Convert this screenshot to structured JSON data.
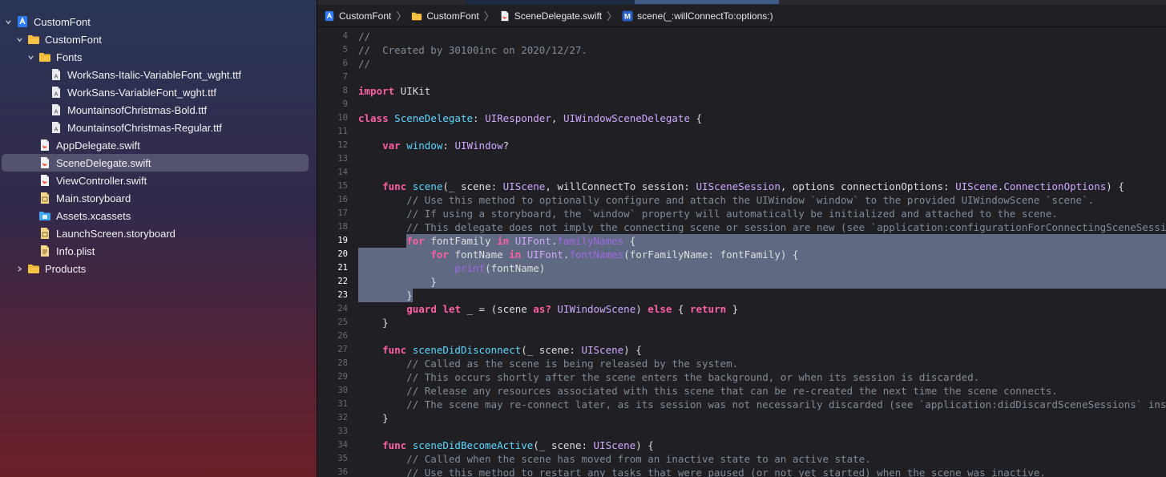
{
  "navigator": {
    "items": [
      {
        "label": "CustomFont",
        "indent": 0,
        "disclosure": "down",
        "icon": "xcode-project-icon",
        "selected": false
      },
      {
        "label": "CustomFont",
        "indent": 1,
        "disclosure": "down",
        "icon": "folder-icon",
        "selected": false
      },
      {
        "label": "Fonts",
        "indent": 2,
        "disclosure": "down",
        "icon": "folder-icon",
        "selected": false
      },
      {
        "label": "WorkSans-Italic-VariableFont_wght.ttf",
        "indent": 3,
        "disclosure": "none",
        "icon": "font-file-icon",
        "selected": false
      },
      {
        "label": "WorkSans-VariableFont_wght.ttf",
        "indent": 3,
        "disclosure": "none",
        "icon": "font-file-icon",
        "selected": false
      },
      {
        "label": "MountainsofChristmas-Bold.ttf",
        "indent": 3,
        "disclosure": "none",
        "icon": "font-file-icon",
        "selected": false
      },
      {
        "label": "MountainsofChristmas-Regular.ttf",
        "indent": 3,
        "disclosure": "none",
        "icon": "font-file-icon",
        "selected": false
      },
      {
        "label": "AppDelegate.swift",
        "indent": 2,
        "disclosure": "none",
        "icon": "swift-file-icon",
        "selected": false
      },
      {
        "label": "SceneDelegate.swift",
        "indent": 2,
        "disclosure": "none",
        "icon": "swift-file-icon",
        "selected": true
      },
      {
        "label": "ViewController.swift",
        "indent": 2,
        "disclosure": "none",
        "icon": "swift-file-icon",
        "selected": false
      },
      {
        "label": "Main.storyboard",
        "indent": 2,
        "disclosure": "none",
        "icon": "storyboard-file-icon",
        "selected": false
      },
      {
        "label": "Assets.xcassets",
        "indent": 2,
        "disclosure": "none",
        "icon": "assets-folder-icon",
        "selected": false
      },
      {
        "label": "LaunchScreen.storyboard",
        "indent": 2,
        "disclosure": "none",
        "icon": "storyboard-file-icon",
        "selected": false
      },
      {
        "label": "Info.plist",
        "indent": 2,
        "disclosure": "none",
        "icon": "plist-file-icon",
        "selected": false
      },
      {
        "label": "Products",
        "indent": 1,
        "disclosure": "right",
        "icon": "folder-icon",
        "selected": false
      }
    ]
  },
  "jumpbar": {
    "crumbs": [
      {
        "label": "CustomFont",
        "icon": "xcode-project-icon"
      },
      {
        "label": "CustomFont",
        "icon": "folder-icon"
      },
      {
        "label": "SceneDelegate.swift",
        "icon": "swift-file-icon"
      },
      {
        "label": "scene(_:willConnectTo:options:)",
        "icon": "method-icon"
      }
    ],
    "separator": "〉",
    "method_badge": "M"
  },
  "editor": {
    "highlighted_lines": [
      19,
      20,
      21,
      22,
      23
    ],
    "lines": [
      {
        "n": 4,
        "spans": [
          [
            "cm",
            "//"
          ]
        ]
      },
      {
        "n": 5,
        "spans": [
          [
            "cm",
            "//  Created by 30100inc on 2020/12/27."
          ]
        ]
      },
      {
        "n": 6,
        "spans": [
          [
            "cm",
            "//"
          ]
        ]
      },
      {
        "n": 7,
        "spans": []
      },
      {
        "n": 8,
        "spans": [
          [
            "kw",
            "import"
          ],
          [
            "",
            " UIKit"
          ]
        ]
      },
      {
        "n": 9,
        "spans": []
      },
      {
        "n": 10,
        "spans": [
          [
            "kw",
            "class"
          ],
          [
            "",
            " "
          ],
          [
            "fn",
            "SceneDelegate"
          ],
          [
            "",
            ": "
          ],
          [
            "ty",
            "UIResponder"
          ],
          [
            "",
            ", "
          ],
          [
            "ty",
            "UIWindowSceneDelegate"
          ],
          [
            "",
            " {"
          ]
        ]
      },
      {
        "n": 11,
        "spans": []
      },
      {
        "n": 12,
        "spans": [
          [
            "",
            "    "
          ],
          [
            "kw",
            "var"
          ],
          [
            "",
            " "
          ],
          [
            "fn",
            "window"
          ],
          [
            "",
            ": "
          ],
          [
            "ty",
            "UIWindow"
          ],
          [
            "",
            "?"
          ]
        ]
      },
      {
        "n": 13,
        "spans": []
      },
      {
        "n": 14,
        "spans": []
      },
      {
        "n": 15,
        "spans": [
          [
            "",
            "    "
          ],
          [
            "kw",
            "func"
          ],
          [
            "",
            " "
          ],
          [
            "fn",
            "scene"
          ],
          [
            "",
            "(_ scene: "
          ],
          [
            "ty",
            "UIScene"
          ],
          [
            "",
            ", willConnectTo session: "
          ],
          [
            "ty",
            "UISceneSession"
          ],
          [
            "",
            ", options connectionOptions: "
          ],
          [
            "ty",
            "UIScene"
          ],
          [
            "",
            "."
          ],
          [
            "ty",
            "ConnectionOptions"
          ],
          [
            "",
            ") {"
          ]
        ]
      },
      {
        "n": 16,
        "spans": [
          [
            "cm",
            "        // Use this method to optionally configure and attach the UIWindow `window` to the provided UIWindowScene `scene`."
          ]
        ]
      },
      {
        "n": 17,
        "spans": [
          [
            "cm",
            "        // If using a storyboard, the `window` property will automatically be initialized and attached to the scene."
          ]
        ]
      },
      {
        "n": 18,
        "spans": [
          [
            "cm",
            "        // This delegate does not imply the connecting scene or session are new (see `application:configurationForConnectingSceneSession` instead)."
          ]
        ]
      },
      {
        "n": 19,
        "spans": [
          [
            "",
            "        "
          ],
          [
            "kw",
            "for"
          ],
          [
            "",
            " fontFamily "
          ],
          [
            "kw",
            "in"
          ],
          [
            "",
            " "
          ],
          [
            "ty",
            "UIFont"
          ],
          [
            "",
            "."
          ],
          [
            "prop",
            "familyNames"
          ],
          [
            "",
            " {"
          ]
        ]
      },
      {
        "n": 20,
        "spans": [
          [
            "",
            "            "
          ],
          [
            "kw",
            "for"
          ],
          [
            "",
            " fontName "
          ],
          [
            "kw",
            "in"
          ],
          [
            "",
            " "
          ],
          [
            "ty",
            "UIFont"
          ],
          [
            "",
            "."
          ],
          [
            "prop",
            "fontNames"
          ],
          [
            "",
            "(forFamilyName: fontFamily) {"
          ]
        ]
      },
      {
        "n": 21,
        "spans": [
          [
            "",
            "                "
          ],
          [
            "fnc",
            "print"
          ],
          [
            "",
            "(fontName)"
          ]
        ]
      },
      {
        "n": 22,
        "spans": [
          [
            "",
            "            }"
          ]
        ]
      },
      {
        "n": 23,
        "spans": [
          [
            "",
            "        }"
          ]
        ]
      },
      {
        "n": 24,
        "spans": [
          [
            "",
            "        "
          ],
          [
            "kw",
            "guard"
          ],
          [
            "",
            " "
          ],
          [
            "kw",
            "let"
          ],
          [
            "",
            " _ = (scene "
          ],
          [
            "kw",
            "as?"
          ],
          [
            "",
            " "
          ],
          [
            "ty",
            "UIWindowScene"
          ],
          [
            "",
            ") "
          ],
          [
            "kw",
            "else"
          ],
          [
            "",
            " { "
          ],
          [
            "kw",
            "return"
          ],
          [
            "",
            " }"
          ]
        ]
      },
      {
        "n": 25,
        "spans": [
          [
            "",
            "    }"
          ]
        ]
      },
      {
        "n": 26,
        "spans": []
      },
      {
        "n": 27,
        "spans": [
          [
            "",
            "    "
          ],
          [
            "kw",
            "func"
          ],
          [
            "",
            " "
          ],
          [
            "fn",
            "sceneDidDisconnect"
          ],
          [
            "",
            "(_ scene: "
          ],
          [
            "ty",
            "UIScene"
          ],
          [
            "",
            ") {"
          ]
        ]
      },
      {
        "n": 28,
        "spans": [
          [
            "cm",
            "        // Called as the scene is being released by the system."
          ]
        ]
      },
      {
        "n": 29,
        "spans": [
          [
            "cm",
            "        // This occurs shortly after the scene enters the background, or when its session is discarded."
          ]
        ]
      },
      {
        "n": 30,
        "spans": [
          [
            "cm",
            "        // Release any resources associated with this scene that can be re-created the next time the scene connects."
          ]
        ]
      },
      {
        "n": 31,
        "spans": [
          [
            "cm",
            "        // The scene may re-connect later, as its session was not necessarily discarded (see `application:didDiscardSceneSessions` instead)."
          ]
        ]
      },
      {
        "n": 32,
        "spans": [
          [
            "",
            "    }"
          ]
        ]
      },
      {
        "n": 33,
        "spans": []
      },
      {
        "n": 34,
        "spans": [
          [
            "",
            "    "
          ],
          [
            "kw",
            "func"
          ],
          [
            "",
            " "
          ],
          [
            "fn",
            "sceneDidBecomeActive"
          ],
          [
            "",
            "(_ scene: "
          ],
          [
            "ty",
            "UIScene"
          ],
          [
            "",
            ") {"
          ]
        ]
      },
      {
        "n": 35,
        "spans": [
          [
            "cm",
            "        // Called when the scene has moved from an inactive state to an active state."
          ]
        ]
      },
      {
        "n": 36,
        "spans": [
          [
            "cm",
            "        // Use this method to restart any tasks that were paused (or not yet started) when the scene was inactive."
          ]
        ]
      }
    ]
  },
  "colors": {
    "keyword": "#fc5fa3",
    "type": "#d0a8ff",
    "comment": "#7f8c98",
    "declaration": "#5dd8ff",
    "selection": "#5f6a82",
    "editor_background": "#1f1f24"
  }
}
